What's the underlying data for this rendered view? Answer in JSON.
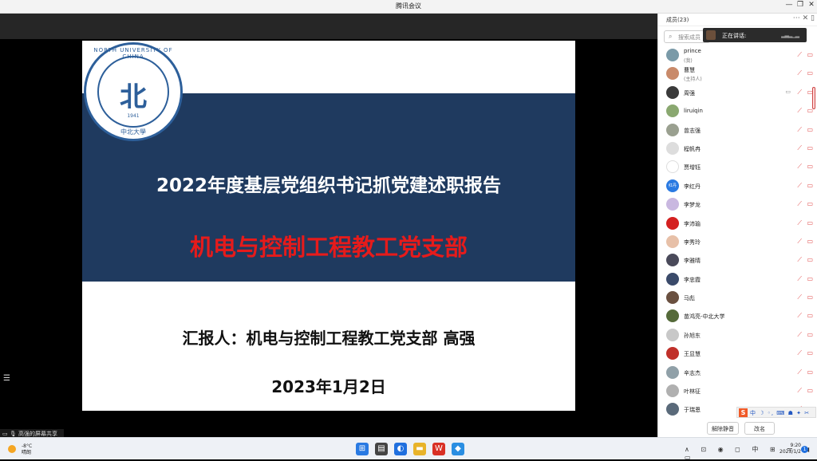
{
  "window": {
    "title": "腾讯会议",
    "controls": [
      "—",
      "❐",
      "✕"
    ]
  },
  "slide": {
    "logo": {
      "ring_text": "NORTH UNIVERSITY OF CHINA",
      "glyph": "北",
      "year": "1941",
      "cn": "中北大學"
    },
    "title": "2022年度基层党组织书记抓党建述职报告",
    "subtitle": "机电与控制工程教工党支部",
    "reporter": "汇报人：机电与控制工程教工党支部  高强",
    "date": "2023年1月2日"
  },
  "share_bar": {
    "label": "高强的屏幕共享"
  },
  "panel": {
    "title": "成员(23)",
    "header_icons": "⋯ ✕ ▯",
    "search_placeholder": "搜索成员",
    "speaking_label": "正在讲话:",
    "speaking_dots": "▂▃▂▁▂",
    "members": [
      {
        "name": "prince",
        "sub": "(我)",
        "color": "#7a9aa8"
      },
      {
        "name": "曹慧",
        "sub": "(主持人)",
        "color": "#c98a6a"
      },
      {
        "name": "周强",
        "sub": "",
        "color": "#3a3a3a",
        "screen": true
      },
      {
        "name": "liruiqin",
        "sub": "",
        "color": "#8aa870"
      },
      {
        "name": "曾志强",
        "sub": "",
        "color": "#9aa090"
      },
      {
        "name": "程帆冉",
        "sub": "",
        "color": "#dddddd"
      },
      {
        "name": "贾增钰",
        "sub": "",
        "color": "#ffffff"
      },
      {
        "name": "李红丹",
        "sub": "",
        "color": "#2a7ae2",
        "initials": "红丹"
      },
      {
        "name": "李梦龙",
        "sub": "",
        "color": "#c9b8e0"
      },
      {
        "name": "李沛瑜",
        "sub": "",
        "color": "#d42020"
      },
      {
        "name": "李秀玲",
        "sub": "",
        "color": "#e7c0a8"
      },
      {
        "name": "李雅晴",
        "sub": "",
        "color": "#4a4a5a"
      },
      {
        "name": "李忠霞",
        "sub": "",
        "color": "#3a4a6a"
      },
      {
        "name": "马彪",
        "sub": "",
        "color": "#6a5040"
      },
      {
        "name": "苗鸿亮-中北大学",
        "sub": "",
        "color": "#556a3a"
      },
      {
        "name": "孙旭东",
        "sub": "",
        "color": "#c8c8c8"
      },
      {
        "name": "王显慧",
        "sub": "",
        "color": "#c0302a"
      },
      {
        "name": "辛志杰",
        "sub": "",
        "color": "#90a0a8"
      },
      {
        "name": "叶林征",
        "sub": "",
        "color": "#b0b0b0"
      },
      {
        "name": "于瑞恩",
        "sub": "",
        "color": "#5a6a7a"
      }
    ],
    "ime_text": "中 ☽ ◦, ⌨ ☗ ✦ ✂",
    "mute_all_button": "解除静音",
    "rename_button": "改名"
  },
  "taskbar": {
    "weather_temp": "-8°C",
    "weather_desc": "晴朗",
    "tray_icons": "∧ ⊡ ◉ ◻ 中 ⊞ ᯤ ◀ ▭",
    "time": "9:20",
    "date": "2023/1/2",
    "notification_count": "1"
  },
  "colors": {
    "band": "#1f3a5f",
    "subtitle_red": "#e61b1b",
    "panel_bg": "#ffffff"
  }
}
